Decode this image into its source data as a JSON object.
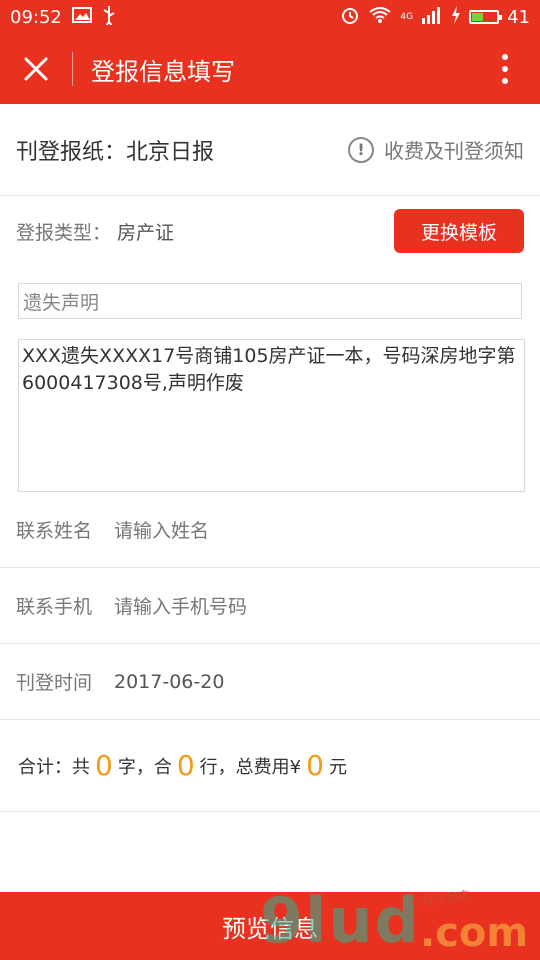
{
  "status_bar": {
    "time": "09:52",
    "network": "4G",
    "battery": "41",
    "battery_level": 0.41
  },
  "nav": {
    "title": "登报信息填写",
    "close_icon": "close-icon",
    "more_icon": "more-vertical-icon"
  },
  "paper": {
    "label": "刊登报纸：北京日报",
    "notice_label": "收费及刊登须知"
  },
  "type": {
    "label": "登报类型：",
    "value": "房产证",
    "change_button": "更换模板"
  },
  "form": {
    "title_value": "遗失声明",
    "content_value": "XXX遗失XXXX17号商铺105房产证一本，号码深房地字第6000417308号,声明作废",
    "contact_name_label": "联系姓名",
    "contact_name_placeholder": "请输入姓名",
    "contact_phone_label": "联系手机",
    "contact_phone_placeholder": "请输入手机号码",
    "date_label": "刊登时间",
    "date_value": "2017-06-20"
  },
  "total": {
    "prefix": "合计：共",
    "chars": "0",
    "chars_unit": "字，合",
    "lines": "0",
    "lines_unit": "行，总费用¥",
    "cost": "0",
    "cost_unit": "元"
  },
  "bottom": {
    "preview_button": "预览信息"
  },
  "watermark": {
    "main": "9lud",
    "suffix": ".com",
    "sub": "小程序商店"
  },
  "colors": {
    "primary": "#e8311f",
    "accent": "#f39a18"
  }
}
